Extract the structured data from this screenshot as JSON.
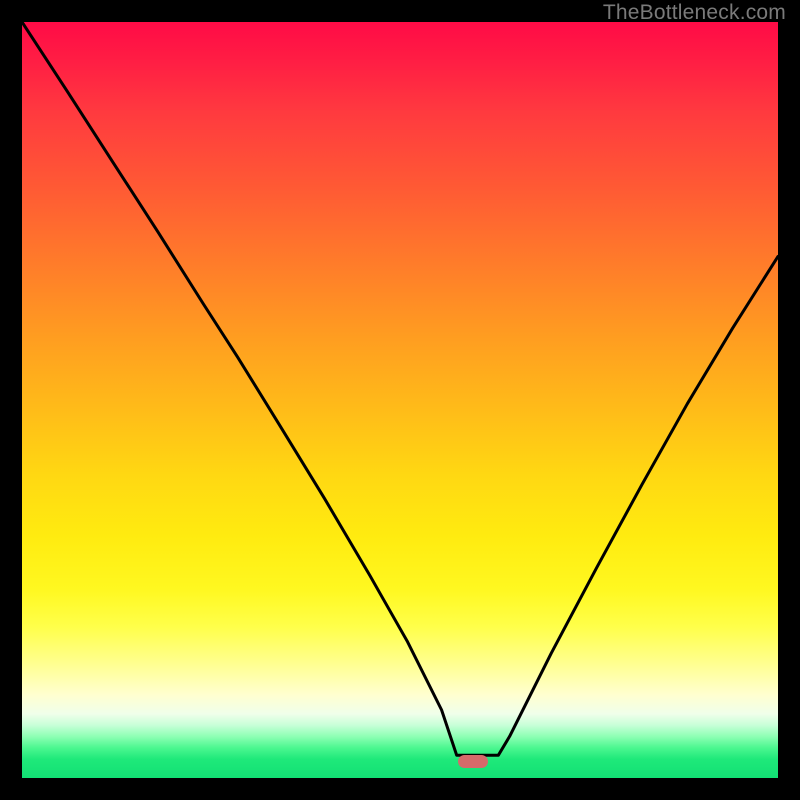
{
  "watermark": "TheBottleneck.com",
  "gradient": {
    "stops": [
      "#ff0b46",
      "#ff3a3f",
      "#ff7c2a",
      "#ffbe18",
      "#ffeb10",
      "#ffff92",
      "#f0ffea",
      "#12e074"
    ]
  },
  "marker": {
    "color": "#d66a6a",
    "x_frac": 0.597,
    "y_frac": 0.978
  },
  "chart_data": {
    "type": "line",
    "title": "",
    "xlabel": "",
    "ylabel": "",
    "xlim": [
      0,
      1
    ],
    "ylim": [
      0,
      1
    ],
    "series": [
      {
        "name": "bottleneck-curve",
        "x": [
          0.0,
          0.06,
          0.12,
          0.18,
          0.24,
          0.285,
          0.34,
          0.4,
          0.46,
          0.51,
          0.555,
          0.575,
          0.63,
          0.645,
          0.7,
          0.76,
          0.82,
          0.88,
          0.94,
          1.0
        ],
        "y": [
          1.0,
          0.908,
          0.815,
          0.722,
          0.627,
          0.557,
          0.468,
          0.37,
          0.268,
          0.18,
          0.09,
          0.03,
          0.03,
          0.055,
          0.165,
          0.278,
          0.388,
          0.495,
          0.595,
          0.69
        ]
      }
    ],
    "annotations": []
  }
}
